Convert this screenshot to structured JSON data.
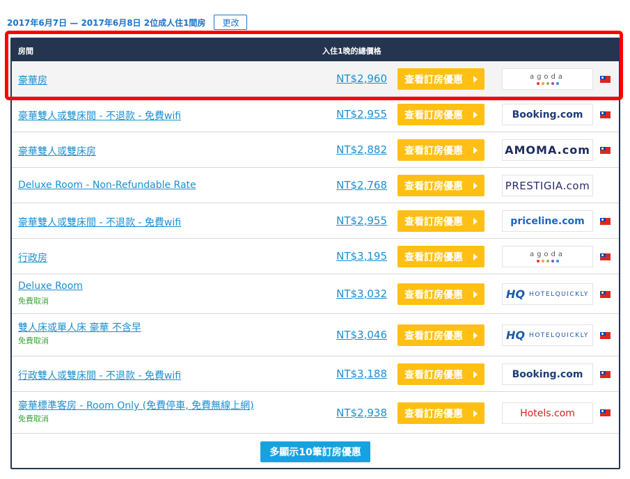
{
  "search": {
    "dates_summary": "2017年6月7日 — 2017年6月8日 2位成人住1間房",
    "change_label": "更改"
  },
  "table": {
    "col_room": "房間",
    "col_price": "入住1晚的總價格",
    "deal_button_label": "查看訂房優惠",
    "rows": [
      {
        "room": "豪華房",
        "note": "",
        "price": "NT$2,960",
        "provider": "agoda",
        "flag": "tw-flag-icon"
      },
      {
        "room": "豪華雙人或雙床間 - 不退款 - 免費wifi",
        "note": "",
        "price": "NT$2,955",
        "provider": "Booking.com",
        "flag": "tw-flag-icon"
      },
      {
        "room": "豪華雙人或雙床房",
        "note": "",
        "price": "NT$2,882",
        "provider": "AMOMA.com",
        "flag": "tw-flag-icon"
      },
      {
        "room": "Deluxe Room - Non-Refundable Rate",
        "note": "",
        "price": "NT$2,768",
        "provider": "PRESTIGIA.com",
        "flag": ""
      },
      {
        "room": "豪華雙人或雙床間 - 不退款 - 免費wifi",
        "note": "",
        "price": "NT$2,955",
        "provider": "priceline.com",
        "flag": "tw-flag-icon"
      },
      {
        "room": "行政房",
        "note": "",
        "price": "NT$3,195",
        "provider": "agoda",
        "flag": "tw-flag-icon"
      },
      {
        "room": "Deluxe Room",
        "note": "免費取消",
        "price": "NT$3,032",
        "provider": "HOTELQUICKLY",
        "flag": "tw-flag-icon"
      },
      {
        "room": "雙人床或單人床 豪華 不含早",
        "note": "免費取消",
        "price": "NT$3,046",
        "provider": "HOTELQUICKLY",
        "flag": "tw-flag-icon"
      },
      {
        "room": "行政雙人或雙床間 - 不退款 - 免費wifi",
        "note": "",
        "price": "NT$3,188",
        "provider": "Booking.com",
        "flag": "tw-flag-icon"
      },
      {
        "room": "豪華標準客房 - Room Only (免費停車, 免費無線上網)",
        "note": "免費取消",
        "price": "NT$2,938",
        "provider": "Hotels.com",
        "flag": "tw-flag-icon"
      }
    ]
  },
  "more_button_label": "多顯示10筆訂房優惠",
  "colors": {
    "header_bg": "#253550",
    "link_blue": "#1a8fd1",
    "deal_button": "#ffbf14",
    "more_button": "#15a3e0",
    "free_cancel_green": "#3aa33a",
    "highlight_red": "#ff0000"
  }
}
